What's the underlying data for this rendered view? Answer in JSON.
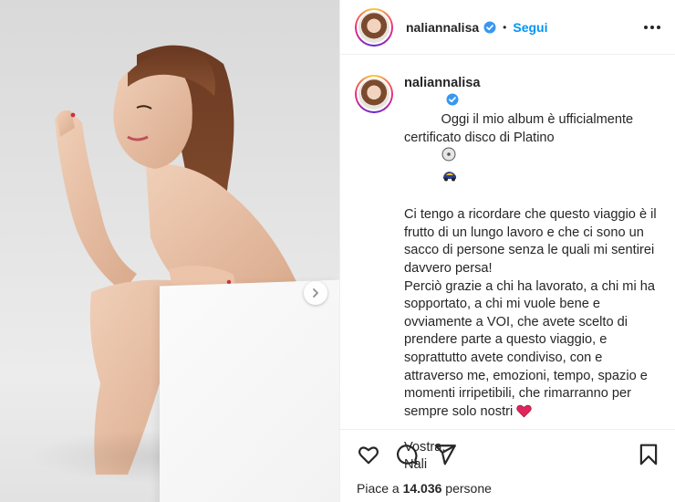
{
  "post": {
    "username": "naliannalisa",
    "follow_label": "Segui",
    "dot": "•",
    "caption_text": "Oggi il mio album è ufficialmente certificato disco di Platino",
    "caption_rest": "Ci tengo a ricordare che questo viaggio è il frutto di un lungo lavoro e che ci sono un sacco di persone senza le quali mi sentirei davvero persa!\nPerciò grazie a chi ha lavorato, a chi mi ha sopportato, a chi mi vuole bene e ovviamente a VOI, che avete scelto di prendere parte a questo viaggio, e soprattutto avete condiviso, con e attraverso me, emozioni, tempo, spazio e momenti irripetibili, che rimarranno per sempre solo nostri",
    "caption_sign": "Vostra,\nNali",
    "likes_prefix": "Piace a ",
    "likes_count": "14.036",
    "likes_suffix": " persone"
  },
  "icons": {
    "verified": "verified-badge-icon",
    "more": "more-options-icon",
    "next": "chevron-right-icon",
    "like": "heart-icon",
    "comment": "comment-icon",
    "share": "send-icon",
    "save": "bookmark-icon",
    "disc": "disc-emoji",
    "car": "car-emoji",
    "heart_emoji": "red-heart-emoji"
  },
  "colors": {
    "accent": "#0095f6",
    "text": "#262626",
    "heart": "#e0245e"
  }
}
